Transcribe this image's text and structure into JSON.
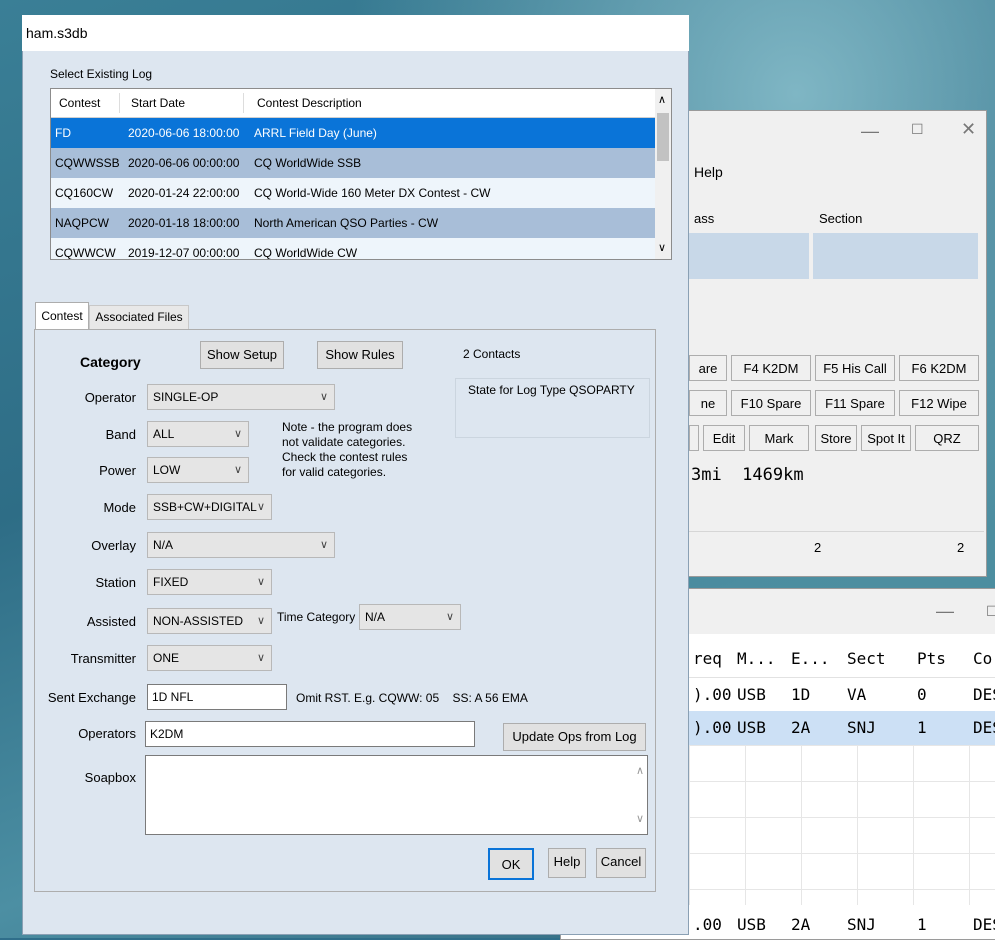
{
  "dialog": {
    "title": "ham.s3db",
    "select_log_label": "Select Existing Log",
    "columns": [
      "Contest",
      "Start Date",
      "Contest Description"
    ],
    "logs": [
      {
        "contest": "FD",
        "start": "2020-06-06 18:00:00",
        "desc": "ARRL Field Day (June)"
      },
      {
        "contest": "CQWWSSB",
        "start": "2020-06-06 00:00:00",
        "desc": "CQ WorldWide SSB"
      },
      {
        "contest": "CQ160CW",
        "start": "2020-01-24 22:00:00",
        "desc": "CQ World-Wide 160 Meter DX Contest - CW"
      },
      {
        "contest": "NAQPCW",
        "start": "2020-01-18 18:00:00",
        "desc": "North American QSO Parties - CW"
      },
      {
        "contest": "CQWWCW",
        "start": "2019-12-07 00:00:00",
        "desc": "CQ WorldWide CW"
      }
    ],
    "tabs": [
      "Contest",
      "Associated Files"
    ],
    "category_label": "Category",
    "show_setup": "Show Setup",
    "show_rules": "Show Rules",
    "contacts": "2 Contacts",
    "state_label": "State for Log Type QSOPARTY",
    "fields": {
      "operator": {
        "label": "Operator",
        "value": "SINGLE-OP"
      },
      "band": {
        "label": "Band",
        "value": "ALL"
      },
      "power": {
        "label": "Power",
        "value": "LOW"
      },
      "mode": {
        "label": "Mode",
        "value": "SSB+CW+DIGITAL"
      },
      "overlay": {
        "label": "Overlay",
        "value": "N/A"
      },
      "station": {
        "label": "Station",
        "value": "FIXED"
      },
      "assisted": {
        "label": "Assisted",
        "value": "NON-ASSISTED"
      },
      "time_category": {
        "label": "Time Category",
        "value": "N/A"
      },
      "transmitter": {
        "label": "Transmitter",
        "value": "ONE"
      }
    },
    "note": [
      "Note -  the program does",
      "not validate categories.",
      "Check the contest rules",
      "for valid categories."
    ],
    "sent_exchange_label": "Sent Exchange",
    "sent_exchange_value": "1D NFL",
    "exchange_hint": "Omit RST. E.g. CQWW: 05    SS: A 56 EMA",
    "operators_label": "Operators",
    "operators_value": "K2DM",
    "update_ops": "Update Ops from Log",
    "soapbox_label": "Soapbox",
    "ok": "OK",
    "help": "Help",
    "cancel": "Cancel"
  },
  "bg_window": {
    "menu_help": "Help",
    "col_class_partial": "ass",
    "col_section": "Section",
    "fkeys_row1": [
      "are",
      "F4 K2DM",
      "F5 His Call",
      "F6 K2DM"
    ],
    "fkeys_row2": [
      "ne",
      "F10 Spare",
      "F11 Spare",
      "F12 Wipe"
    ],
    "actions": [
      "Edit",
      "Mark",
      "Store",
      "Spot It",
      "QRZ"
    ],
    "distance": "3mi  1469km",
    "status_left": "2",
    "status_right": "2"
  },
  "log_window": {
    "headers": [
      "req",
      "M...",
      "E...",
      "Sect",
      "Pts",
      "Co"
    ],
    "rows": [
      [
        ").00",
        "USB",
        "1D",
        "VA",
        "0",
        "DES"
      ],
      [
        ").00",
        "USB",
        "2A",
        "SNJ",
        "1",
        "DES"
      ]
    ],
    "bottom_row": [
      ".00",
      "USB",
      "2A",
      "SNJ",
      "1",
      "DES"
    ]
  }
}
